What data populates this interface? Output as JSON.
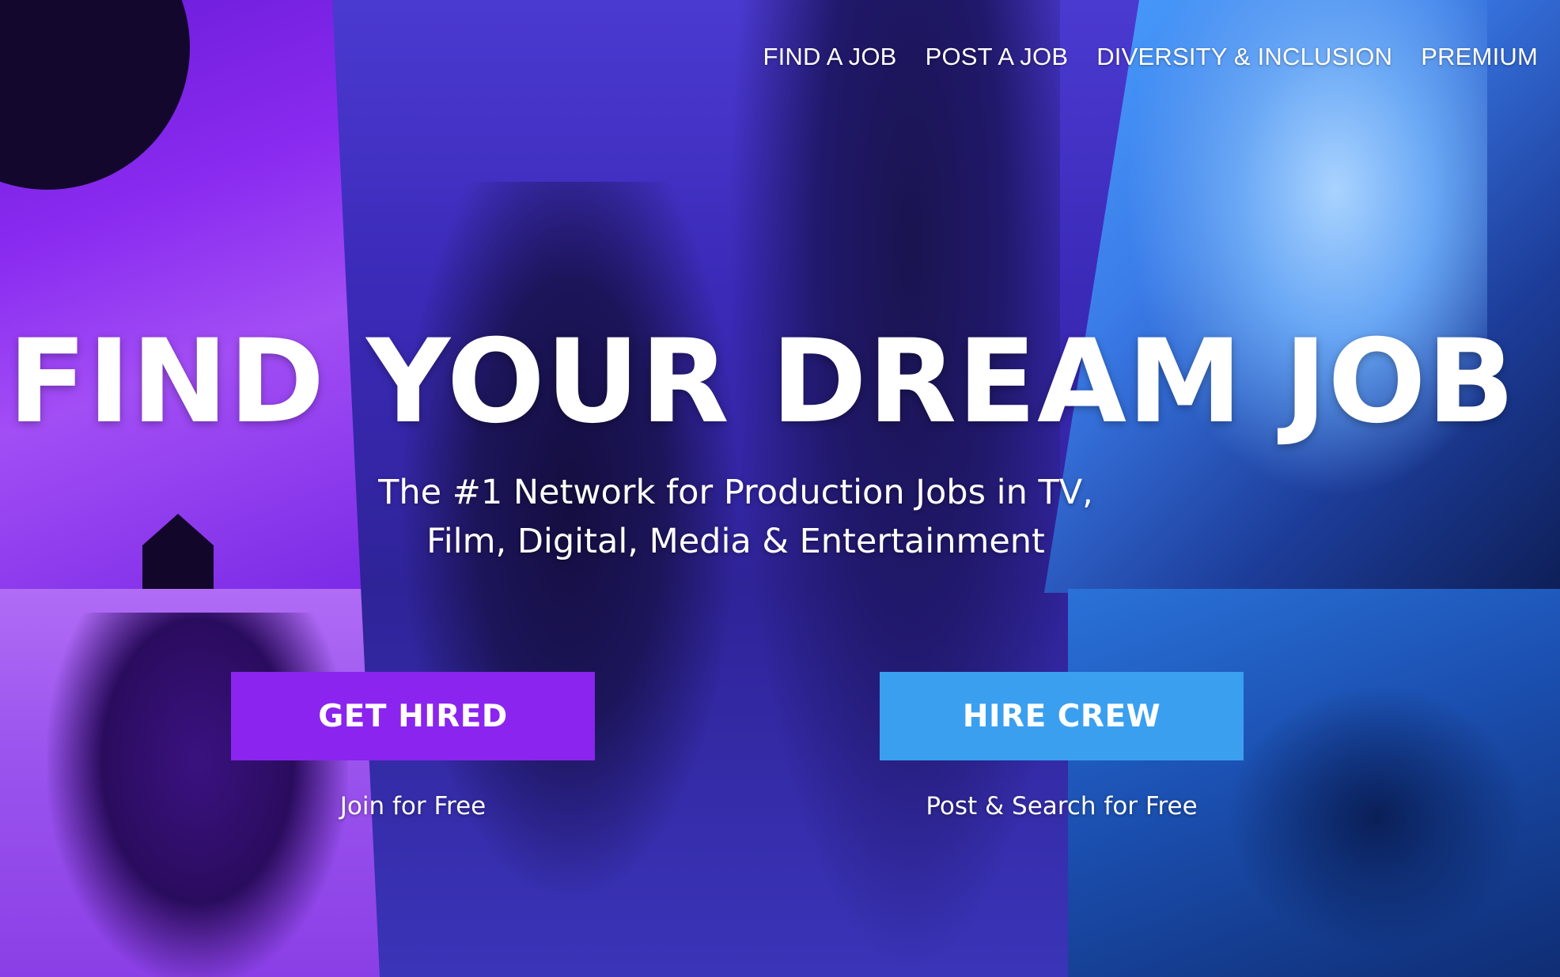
{
  "nav": {
    "items": [
      {
        "label": "FIND A JOB"
      },
      {
        "label": "POST A JOB"
      },
      {
        "label": "DIVERSITY & INCLUSION"
      },
      {
        "label": "PREMIUM"
      }
    ]
  },
  "hero": {
    "headline": "FIND YOUR DREAM JOB",
    "subhead_line1": "The #1 Network for Production Jobs in TV,",
    "subhead_line2": "Film, Digital, Media & Entertainment"
  },
  "cta": {
    "get_hired": {
      "label": "GET HIRED",
      "sublabel": "Join for Free",
      "color": "#8a24ee"
    },
    "hire_crew": {
      "label": "HIRE CREW",
      "sublabel": "Post & Search for Free",
      "color": "#3b9ff0"
    }
  },
  "colors": {
    "purple": "#8a24ee",
    "blue": "#3b9ff0",
    "text": "#ffffff"
  }
}
